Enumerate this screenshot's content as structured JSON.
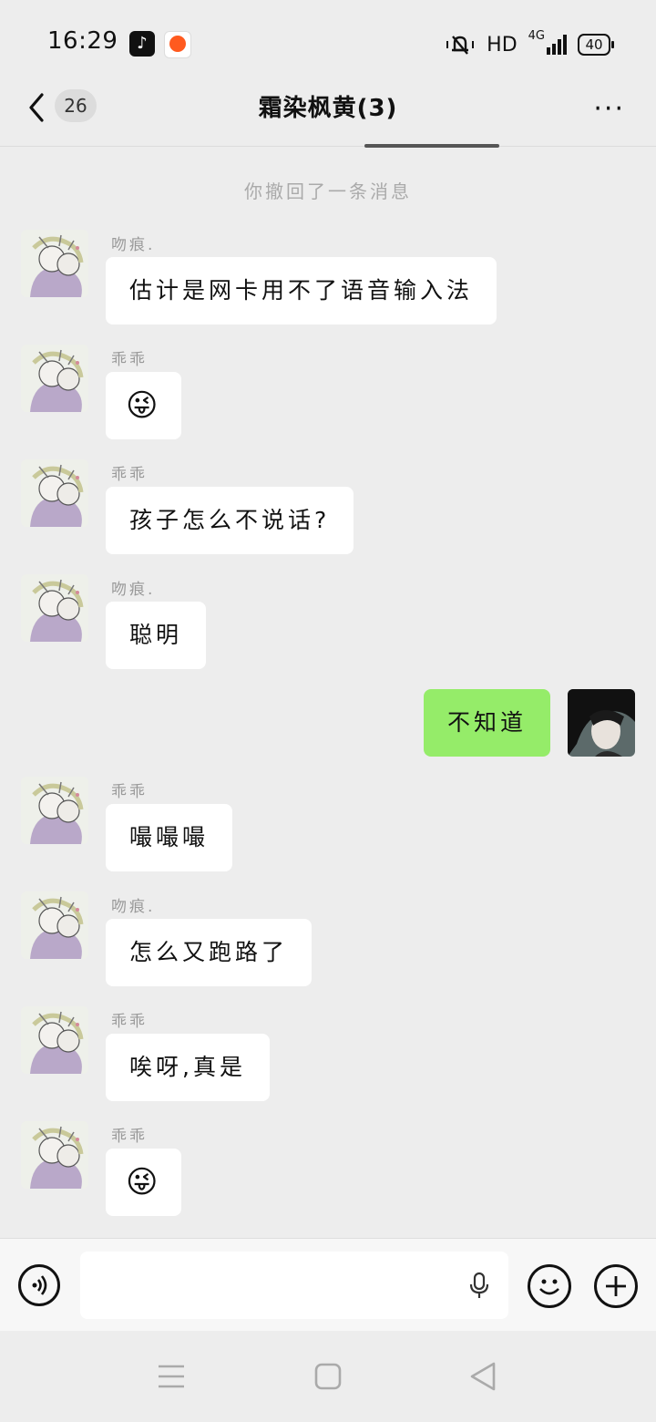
{
  "status_bar": {
    "time": "16:29",
    "network_label": "HD",
    "network_type": "4G",
    "battery": "40"
  },
  "header": {
    "back_count": "26",
    "chat_title": "霜染枫黄(3)",
    "more_label": "···"
  },
  "system_note": "你撤回了一条消息",
  "messages": [
    {
      "sender": "吻痕.",
      "text": "估计是网卡用不了语音输入法",
      "mine": false
    },
    {
      "sender": "乖乖",
      "text": "😜",
      "mine": false,
      "emoji": true
    },
    {
      "sender": "乖乖",
      "text": "孩子怎么不说话?",
      "mine": false
    },
    {
      "sender": "吻痕.",
      "text": "聪明",
      "mine": false
    },
    {
      "sender": "",
      "text": "不知道",
      "mine": true
    },
    {
      "sender": "乖乖",
      "text": "嘬嘬嘬",
      "mine": false
    },
    {
      "sender": "吻痕.",
      "text": "怎么又跑路了",
      "mine": false
    },
    {
      "sender": "乖乖",
      "text": "唉呀,真是",
      "mine": false
    },
    {
      "sender": "乖乖",
      "text": "😜",
      "mine": false,
      "emoji": true
    }
  ],
  "input": {
    "placeholder": ""
  },
  "colors": {
    "background": "#ededed",
    "my_bubble": "#95ec69",
    "their_bubble": "#ffffff"
  }
}
